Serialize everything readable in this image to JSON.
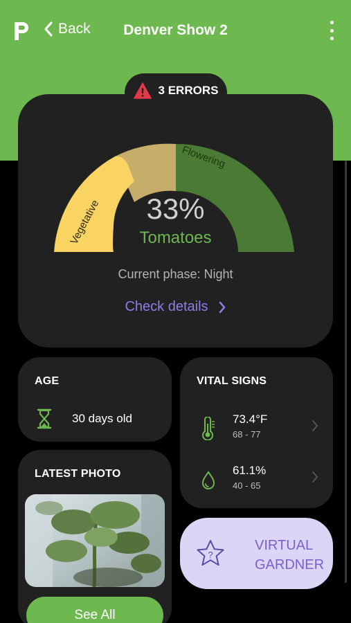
{
  "header": {
    "logo": "planter-logo",
    "back_label": "Back",
    "title": "Denver Show 2",
    "menu_icon": "more-vertical-icon",
    "bg_color": "#6db84f"
  },
  "status": {
    "errors_label": "3 ERRORS",
    "icon": "warning-triangle-icon",
    "icon_color": "#e0394a"
  },
  "growth": {
    "percent_label": "33%",
    "progress": 0.33,
    "plant_name": "Tomatoes",
    "phases": [
      {
        "label": "Vegetative",
        "color": "#f9d462"
      },
      {
        "label": "",
        "color": "#c6ad6a"
      },
      {
        "label": "Flowering",
        "color": "#4a7a33"
      }
    ],
    "current_phase_label": "Current phase: Night",
    "check_details_label": "Check details"
  },
  "age": {
    "title": "AGE",
    "icon": "hourglass-icon",
    "value": "30 days old"
  },
  "vital_signs": {
    "title": "VITAL SIGNS",
    "items": [
      {
        "icon": "thermometer-icon",
        "value": "73.4°F",
        "range": "68 - 77"
      },
      {
        "icon": "water-drop-icon",
        "value": "61.1%",
        "range": "40 - 65"
      }
    ]
  },
  "latest_photo": {
    "title": "LATEST PHOTO",
    "see_all_label": "See All"
  },
  "virtual_gardener": {
    "line1": "VIRTUAL",
    "line2": "GARDNER",
    "icon": "star-question-icon"
  },
  "colors": {
    "accent_green": "#6db84f",
    "accent_purple": "#8b7ee8",
    "card_bg": "#212121"
  }
}
